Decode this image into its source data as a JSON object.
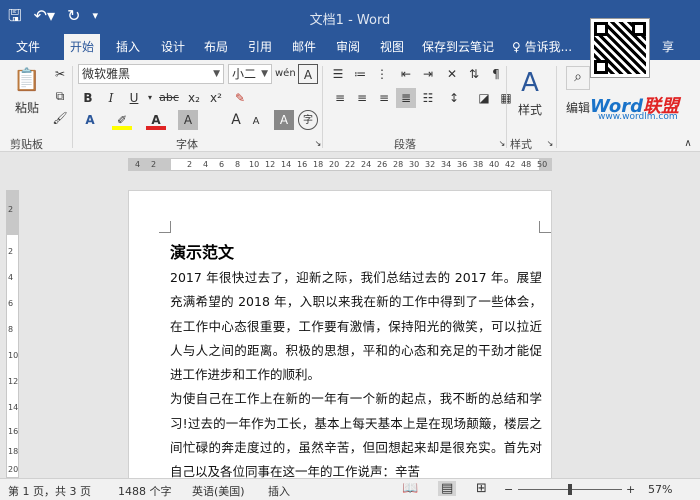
{
  "window": {
    "title": "文档1 - Word"
  },
  "qat": {
    "save_icon": "save-icon",
    "undo_icon": "undo-icon",
    "redo_icon": "redo-icon",
    "customize": "▾"
  },
  "tabs": [
    "文件",
    "开始",
    "插入",
    "设计",
    "布局",
    "引用",
    "邮件",
    "审阅",
    "视图",
    "保存到云笔记",
    "告诉我..."
  ],
  "share": "享",
  "ribbon": {
    "clipboard": {
      "paste_label": "粘贴",
      "group_label": "剪贴板"
    },
    "font": {
      "name": "微软雅黑",
      "size": "小二",
      "group_label": "字体",
      "bold": "B",
      "italic": "I",
      "underline": "U",
      "strike": "abc",
      "sub": "x₂",
      "sup": "x²",
      "grow": "A",
      "shrink": "A",
      "case": "Aa",
      "clear": "A",
      "char_shade": "A",
      "encircle": "字",
      "font_color_hex": "#e02424",
      "highlight_hex": "#ffff00"
    },
    "paragraph": {
      "group_label": "段落"
    },
    "styles": {
      "label": "样式",
      "group_label": "样式"
    },
    "editing": {
      "label": "编辑"
    }
  },
  "watermark": {
    "brand_word": "Word",
    "brand_cn": "联盟",
    "site": "www.wordlm.com"
  },
  "ruler": {
    "h_left": [
      "4",
      "2"
    ],
    "h_nums": [
      "2",
      "4",
      "6",
      "8",
      "10",
      "12",
      "14",
      "16",
      "18",
      "20",
      "22",
      "24",
      "26",
      "28",
      "30",
      "32",
      "34",
      "36",
      "38",
      "40",
      "42"
    ],
    "h_right": [
      "48",
      "50"
    ],
    "v_nums": [
      "2",
      "2",
      "4",
      "6",
      "8",
      "10",
      "12",
      "14",
      "16",
      "18",
      "20"
    ]
  },
  "document": {
    "title": "演示范文",
    "paragraphs": [
      "2017 年很快过去了，迎新之际，我们总结过去的 2017 年。展望充满希望的 2018 年，入职以来我在新的工作中得到了一些体会，在工作中心态很重要，工作要有激情，保持阳光的微笑，可以拉近人与人之间的距离。积极的思想，平和的心态和充足的干劲才能促进工作进步和工作的顺利。",
      "为使自己在工作上在新的一年有一个新的起点，我不断的总结和学习!过去的一年作为工长，基本上每天基本上是在现场颠簸，楼层之间忙碌的奔走度过的，虽然辛苦，但回想起来却是很充实。首先对自己以及各位同事在这一年的工作说声：辛苦"
    ]
  },
  "status": {
    "page": "第 1 页，共 3 页",
    "words": "1488 个字",
    "lang": "英语(美国)",
    "mode": "插入",
    "zoom": "57%",
    "zoom_minus": "−",
    "zoom_plus": "+"
  },
  "colors": {
    "brand": "#2b579a",
    "ribbon_bg": "#f3f3f3"
  }
}
